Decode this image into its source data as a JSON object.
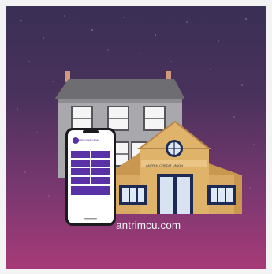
{
  "illustration": {
    "url_text": "antrimcu.com",
    "sign_text": "ANTRIM CREDIT UNION",
    "app_brand": "Antrim Credit Union"
  },
  "colors": {
    "sky_top": "#3a2f55",
    "sky_bottom": "#a63a78",
    "building_grey": "#a9a9ad",
    "building_tan": "#d7a764",
    "phone_purple": "#5a32a8"
  }
}
